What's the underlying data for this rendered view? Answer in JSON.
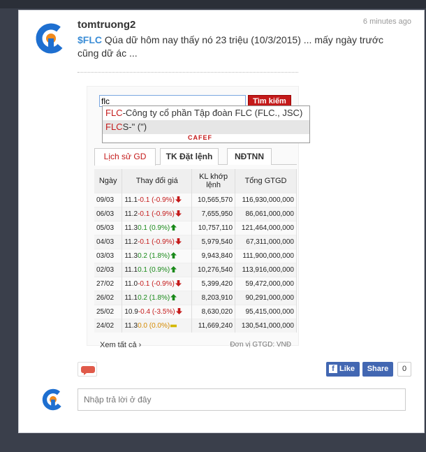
{
  "post": {
    "username": "tomtruong2",
    "timestamp": "6 minutes ago",
    "ticker": "$FLC",
    "body": " Qúa dữ hôm nay thấy nó 23 triệu (10/3/2015) ... mấy ngày trước cũng dữ ác ..."
  },
  "widget": {
    "search_value": "flc",
    "search_button": "Tìm kiếm",
    "suggestions": [
      {
        "prefix": "FLC",
        "rest": "-Công ty cổ phần Tập đoàn FLC (FLC., JSC)"
      },
      {
        "prefix": "FLC",
        "rest": "S-\" (\")"
      }
    ],
    "logo_text": "CAFEF",
    "tabs": [
      "Lịch sử GD",
      "TK Đặt lệnh",
      "NĐTNN"
    ],
    "headers": [
      "Ngày",
      "Thay đổi giá",
      "KL khớp lệnh",
      "Tổng GTGD"
    ],
    "rows": [
      {
        "date": "09/03",
        "price": "11.1",
        "change": "-0.1 (-0.9%)",
        "dir": "down",
        "volume": "10,565,570",
        "value": "116,930,000,000"
      },
      {
        "date": "06/03",
        "price": "11.2",
        "change": "-0.1 (-0.9%)",
        "dir": "down",
        "volume": "7,655,950",
        "value": "86,061,000,000"
      },
      {
        "date": "05/03",
        "price": "11.3",
        "change": "0.1 (0.9%)",
        "dir": "up",
        "volume": "10,757,110",
        "value": "121,464,000,000"
      },
      {
        "date": "04/03",
        "price": "11.2",
        "change": "-0.1 (-0.9%)",
        "dir": "down",
        "volume": "5,979,540",
        "value": "67,311,000,000"
      },
      {
        "date": "03/03",
        "price": "11.3",
        "change": "0.2 (1.8%)",
        "dir": "up",
        "volume": "9,943,840",
        "value": "111,900,000,000"
      },
      {
        "date": "02/03",
        "price": "11.1",
        "change": "0.1 (0.9%)",
        "dir": "up",
        "volume": "10,276,540",
        "value": "113,916,000,000"
      },
      {
        "date": "27/02",
        "price": "11.0",
        "change": "-0.1 (-0.9%)",
        "dir": "down",
        "volume": "5,399,420",
        "value": "59,472,000,000"
      },
      {
        "date": "26/02",
        "price": "11.1",
        "change": "0.2 (1.8%)",
        "dir": "up",
        "volume": "8,203,910",
        "value": "90,291,000,000"
      },
      {
        "date": "25/02",
        "price": "10.9",
        "change": "-0.4 (-3.5%)",
        "dir": "down",
        "volume": "8,630,020",
        "value": "95,415,000,000"
      },
      {
        "date": "24/02",
        "price": "11.3",
        "change": "0.0 (0.0%)",
        "dir": "flat",
        "volume": "11,669,240",
        "value": "130,541,000,000"
      }
    ],
    "more_link": "Xem tất cả",
    "unit_note": "Đơn vị GTGD: VNĐ"
  },
  "actions": {
    "like_label": "Like",
    "share_label": "Share",
    "share_count": "0"
  },
  "reply": {
    "placeholder": "Nhập trả lời ở đây"
  },
  "colors": {
    "accent_red": "#c41a1a",
    "facebook_blue": "#4267b2",
    "ticker_blue": "#3b8dd6"
  }
}
